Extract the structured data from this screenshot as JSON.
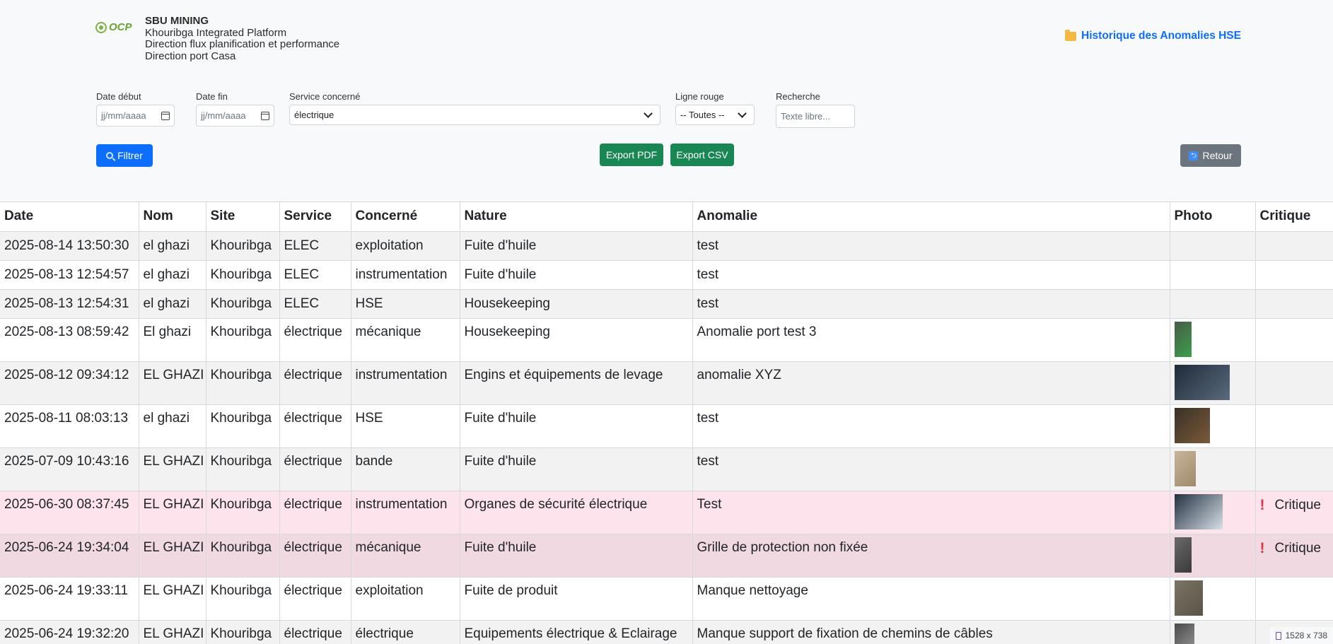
{
  "brand": {
    "logo_text": "OCP",
    "org": "SBU MINING",
    "line1": "Khouribga Integrated Platform",
    "line2": "Direction flux planification et performance",
    "line3": "Direction port Casa"
  },
  "history_link": {
    "label": "Historique des Anomalies HSE",
    "icon": "folder-icon"
  },
  "filters": {
    "date_debut": {
      "label": "Date début",
      "placeholder": "jj/mm/aaaa"
    },
    "date_fin": {
      "label": "Date fin",
      "placeholder": "jj/mm/aaaa"
    },
    "service": {
      "label": "Service concerné",
      "value": "électrique"
    },
    "ligne_rouge": {
      "label": "Ligne rouge",
      "value": "-- Toutes --"
    },
    "recherche": {
      "label": "Recherche",
      "placeholder": "Texte libre..."
    }
  },
  "buttons": {
    "filter": "Filtrer",
    "export_pdf": "Export PDF",
    "export_csv": "Export CSV",
    "back": "Retour"
  },
  "colors": {
    "primary": "#0d6efd",
    "success": "#198754",
    "secondary": "#6c757d",
    "critical_row": "#fde3ec",
    "danger": "#dc3545"
  },
  "table": {
    "headers": [
      "Date",
      "Nom",
      "Site",
      "Service",
      "Concerné",
      "Nature",
      "Anomalie",
      "Photo",
      "Critique"
    ],
    "rows": [
      {
        "date": "2025-08-14 13:50:30",
        "nom": "el ghazi",
        "site": "Khouribga",
        "service": "ELEC",
        "concerne": "exploitation",
        "nature": "Fuite d'huile",
        "anomalie": "test",
        "critique": ""
      },
      {
        "date": "2025-08-13 12:54:57",
        "nom": "el ghazi",
        "site": "Khouribga",
        "service": "ELEC",
        "concerne": "instrumentation",
        "nature": "Fuite d'huile",
        "anomalie": "test",
        "critique": ""
      },
      {
        "date": "2025-08-13 12:54:31",
        "nom": "el ghazi",
        "site": "Khouribga",
        "service": "ELEC",
        "concerne": "HSE",
        "nature": "Housekeeping",
        "anomalie": "test",
        "critique": ""
      },
      {
        "date": "2025-08-13 08:59:42",
        "nom": "El ghazi",
        "site": "Khouribga",
        "service": "électrique",
        "concerne": "mécanique",
        "nature": "Housekeeping",
        "anomalie": "Anomalie port test 3",
        "critique": ""
      },
      {
        "date": "2025-08-12 09:34:12",
        "nom": "EL GHAZI",
        "site": "Khouribga",
        "service": "électrique",
        "concerne": "instrumentation",
        "nature": "Engins et équipements de levage",
        "anomalie": "anomalie XYZ",
        "critique": ""
      },
      {
        "date": "2025-08-11 08:03:13",
        "nom": "el ghazi",
        "site": "Khouribga",
        "service": "électrique",
        "concerne": "HSE",
        "nature": "Fuite d'huile",
        "anomalie": "test",
        "critique": ""
      },
      {
        "date": "2025-07-09 10:43:16",
        "nom": "EL GHAZI",
        "site": "Khouribga",
        "service": "électrique",
        "concerne": "bande",
        "nature": "Fuite d'huile",
        "anomalie": "test",
        "critique": ""
      },
      {
        "date": "2025-06-30 08:37:45",
        "nom": "EL GHAZI",
        "site": "Khouribga",
        "service": "électrique",
        "concerne": "instrumentation",
        "nature": "Organes de sécurité électrique",
        "anomalie": "Test",
        "critique": "Critique"
      },
      {
        "date": "2025-06-24 19:34:04",
        "nom": "EL GHAZI",
        "site": "Khouribga",
        "service": "électrique",
        "concerne": "mécanique",
        "nature": "Fuite d'huile",
        "anomalie": "Grille de protection non fixée",
        "critique": "Critique"
      },
      {
        "date": "2025-06-24 19:33:11",
        "nom": "EL GHAZI",
        "site": "Khouribga",
        "service": "électrique",
        "concerne": "exploitation",
        "nature": "Fuite de produit",
        "anomalie": "Manque nettoyage",
        "critique": ""
      },
      {
        "date": "2025-06-24 19:32:20",
        "nom": "EL GHAZI",
        "site": "Khouribga",
        "service": "électrique",
        "concerne": "électrique",
        "nature": "Equipements électrique & Eclairage",
        "anomalie": "Manque support de fixation de chemins de câbles",
        "critique": ""
      }
    ]
  },
  "viewport_badge": "1528 x 738"
}
